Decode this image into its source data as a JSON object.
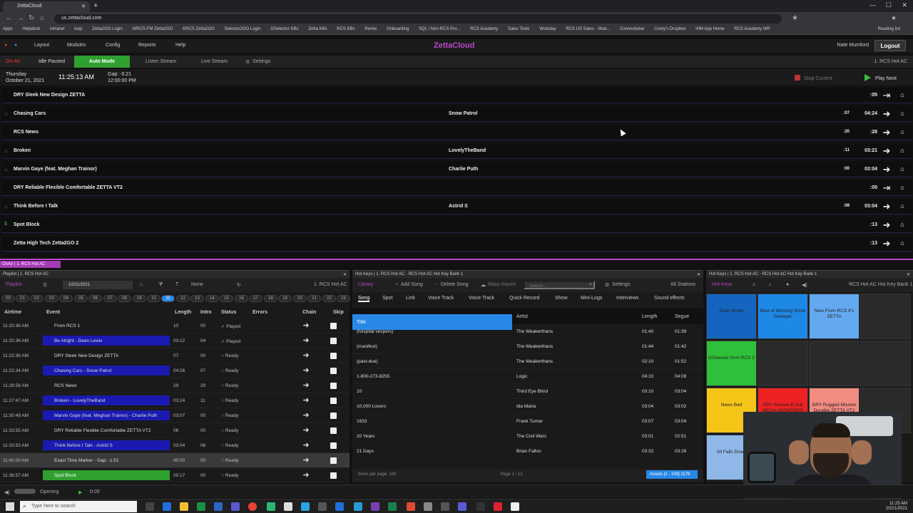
{
  "browser": {
    "tab_title": "ZettaCloud",
    "url": "us.zettacloud.com",
    "bookmarks": [
      "Apps",
      "Helpdesk",
      "Intranet",
      "loop",
      "Zetta2GO Login",
      "WRCS-FM Zetta2GO",
      "KRCS Zetta2GO",
      "Selector2GO Login",
      "GSelector KBs",
      "Zetta KBs",
      "RCS KBs",
      "Remix",
      "Onboarding",
      "SQL / Non-RCS Pro...",
      "RCS Academy",
      "Sales Tools",
      "Workday",
      "RCS US Sales - Shar...",
      "Connectwise",
      "Corey's Dropbox",
      "iHM App Home",
      "RCS Academy WP"
    ],
    "reading_list": "Reading list"
  },
  "app": {
    "brand": "ZettaCloud",
    "menus": [
      "Layout",
      "Modules",
      "Config",
      "Reports",
      "Help"
    ],
    "user": "Nate Mumford",
    "logout": "Logout"
  },
  "toolbar": {
    "on_air": "On-Air",
    "idle_paused": "Idle Paused",
    "auto_mode": "Auto Mode",
    "listen_stream": "Listen Stream",
    "live_stream": "Live Stream",
    "settings": "Settings",
    "station": "1. RCS Hot AC"
  },
  "clock": {
    "day": "Thursday",
    "date": "October 21, 2021",
    "time": "11:25:13 AM",
    "gap": "Gap: -5:21",
    "gap_time": "12:00:00 PM",
    "stop_current": "Stop Current",
    "play_next": "Play Next"
  },
  "log_rows": [
    {
      "title": "DRY Sleek New Design ZETTA",
      "artist": "",
      "intro": "",
      "length": ":05",
      "chain": "⇥"
    },
    {
      "title": "Chasing Cars",
      "artist": "Snow Patrol",
      "intro": ":07",
      "length": "04:24",
      "chain": "➜"
    },
    {
      "title": "RCS News",
      "artist": "",
      "intro": ":20",
      "length": ":28",
      "chain": "➜"
    },
    {
      "title": "Broken",
      "artist": "LovelyTheBand",
      "intro": ":11",
      "length": "03:21",
      "chain": "➜"
    },
    {
      "title": "Marvin Gaye (feat. Meghan Trainor)",
      "artist": "Charlie Puth",
      "intro": ":00",
      "length": "03:04",
      "chain": "➜"
    },
    {
      "title": "DRY Reliable Flexible Comfortable ZETTA VT2",
      "artist": "",
      "intro": "",
      "length": ":05",
      "chain": "⇥"
    },
    {
      "title": "Think Before I Talk",
      "artist": "Astrid S",
      "intro": ":08",
      "length": "03:04",
      "chain": "➜"
    },
    {
      "title": "Spot Block",
      "artist": "",
      "intro": "",
      "length": ":13",
      "chain": "➜"
    },
    {
      "title": "Zetta High Tech Zetta2GO 2",
      "artist": "",
      "intro": "",
      "length": ":13",
      "chain": "➜"
    }
  ],
  "onair_tab": "OnAir | 1. RCS Hot AC",
  "playlist": {
    "header": "Playlist | 1. RCS Hot AC",
    "label": "Playlist",
    "date": "10/21/2021",
    "filter": "None",
    "station": "1. RCS Hot AC",
    "hours": [
      "00",
      "01",
      "02",
      "03",
      "04",
      "05",
      "06",
      "07",
      "08",
      "09",
      "10",
      "11",
      "12",
      "13",
      "14",
      "15",
      "16",
      "17",
      "18",
      "19",
      "20",
      "21",
      "22",
      "23"
    ],
    "selected_hour": "11",
    "columns": [
      "Airtime",
      "Event",
      "Length",
      "Intro",
      "Status",
      "Errors",
      "Chain",
      "Skip"
    ],
    "rows": [
      {
        "airtime": "11:20:36 AM",
        "event": "From RCS 1",
        "length": "10",
        "intro": "00",
        "status": "✓ Played",
        "kind": "plain"
      },
      {
        "airtime": "11:20:36 AM",
        "event": "Be Alright - Dean Lewis",
        "length": "03:12",
        "intro": "04",
        "status": "✓ Played",
        "kind": "song"
      },
      {
        "airtime": "11:22:36 AM",
        "event": "DRY Sleek New Design ZETTA",
        "length": "07",
        "intro": "00",
        "status": "○ Ready",
        "kind": "plain"
      },
      {
        "airtime": "11:22:34 AM",
        "event": "Chasing Cars - Snow Patrol",
        "length": "04:26",
        "intro": "07",
        "status": "○ Ready",
        "kind": "song"
      },
      {
        "airtime": "11:26:58 AM",
        "event": "RCS News",
        "length": "29",
        "intro": "20",
        "status": "○ Ready",
        "kind": "plain"
      },
      {
        "airtime": "11:27:47 AM",
        "event": "Broken - LovelyTheBand",
        "length": "03:24",
        "intro": "11",
        "status": "○ Ready",
        "kind": "song"
      },
      {
        "airtime": "11:30:49 AM",
        "event": "Marvin Gaye (feat. Meghan Trainor) - Charlie Puth",
        "length": "03:07",
        "intro": "00",
        "status": "○ Ready",
        "kind": "song"
      },
      {
        "airtime": "11:33:55 AM",
        "event": "DRY Reliable Flexible Comfortable ZETTA VT2",
        "length": "06",
        "intro": "00",
        "status": "○ Ready",
        "kind": "plain"
      },
      {
        "airtime": "11:33:53 AM",
        "event": "Think Before I Talk - Astrid S",
        "length": "03:04",
        "intro": "08",
        "status": "○ Ready",
        "kind": "song"
      },
      {
        "airtime": "11:40:00 AM",
        "event": "Exact Time Marker - Gap: -1:51",
        "length": "40:00",
        "intro": "00",
        "status": "○ Ready",
        "kind": "marker"
      },
      {
        "airtime": "11:36:57 AM",
        "event": "Spot Block",
        "length": "00:17",
        "intro": "00",
        "status": "○ Ready",
        "kind": "spot"
      }
    ]
  },
  "library": {
    "header": "Hot Keys | 1. RCS Hot AC - RCS Hot AC Hot Key Bank 1",
    "label": "Library",
    "add_song": "Add Song",
    "delete_song": "Delete Song",
    "mass_import": "Mass Import",
    "search_placeholder": "Search...",
    "settings": "Settings",
    "all_stations": "All Stations",
    "tabs": [
      "Song",
      "Spot",
      "Link",
      "Voice Track",
      "Voice Track",
      "Quick Record",
      "Show",
      "Mini-Logs",
      "Interviews",
      "Sound effects"
    ],
    "columns": [
      "Title",
      "Artist",
      "Length",
      "Segue"
    ],
    "rows": [
      [
        "(hospital vespers)",
        "The Weakerthans",
        "01:40",
        "01:39"
      ],
      [
        "(manifest)",
        "The Weakerthans",
        "01:44",
        "01:42"
      ],
      [
        "(past-due)",
        "The Weakerthans",
        "02:10",
        "01:52"
      ],
      [
        "1-800-273-8255",
        "Logic",
        "04:10",
        "04:08"
      ],
      [
        "10",
        "Third Eye Blind",
        "03:10",
        "03:04"
      ],
      [
        "10,000 Lovers",
        "Ida Maria",
        "03:04",
        "03:02"
      ],
      [
        "1933",
        "Frank Turner",
        "03:07",
        "03:04"
      ],
      [
        "20 Years",
        "The Civil Wars",
        "03:01",
        "02:51"
      ],
      [
        "21 Days",
        "Brian Fallon",
        "03:32",
        "03:26"
      ]
    ],
    "items_per_page": "Items per page: 100",
    "page": "Page 1 / 12",
    "assets": "Assets [1 - 100] 1176"
  },
  "hotkeys": {
    "header": "Hot Keys | 1. RCS Hot AC - RCS Hot AC Hot Key Bank 1",
    "label": "Hot Keys",
    "bank": "RCS Hot AC Hot Key Bank 1",
    "keys": [
      {
        "label": "Eeen Brook",
        "color": "#1565c0"
      },
      {
        "label": "Best of Morning Show Sweeper",
        "color": "#1e88e5"
      },
      {
        "label": "New From RCS It's ZETTA",
        "color": "#64a8f0"
      },
      {
        "label": "",
        "color": "#2a2a2a"
      },
      {
        "label": "GSelector from RCS 3",
        "color": "#2fbf3a"
      },
      {
        "label": "",
        "color": "#2a2a2a"
      },
      {
        "label": "",
        "color": "#2a2a2a"
      },
      {
        "label": "",
        "color": "#2a2a2a"
      },
      {
        "label": "News Bed",
        "color": "#f5c518"
      },
      {
        "label": "DRY Sincere E-trial MEDIA MONITORS",
        "color": "#e22"
      },
      {
        "label": "DRY Rugged Mission Durable ZETTA VT2",
        "color": "#f28b80"
      },
      {
        "label": "",
        "color": "#2a2a2a"
      },
      {
        "label": "All Falls Down",
        "color": "#8fb8e8"
      }
    ]
  },
  "status_bar": {
    "mode": "Opening",
    "time": "0:00"
  },
  "taskbar": {
    "search": "Type here to search",
    "time": "11:25 AM",
    "date": "10/21/2021"
  }
}
